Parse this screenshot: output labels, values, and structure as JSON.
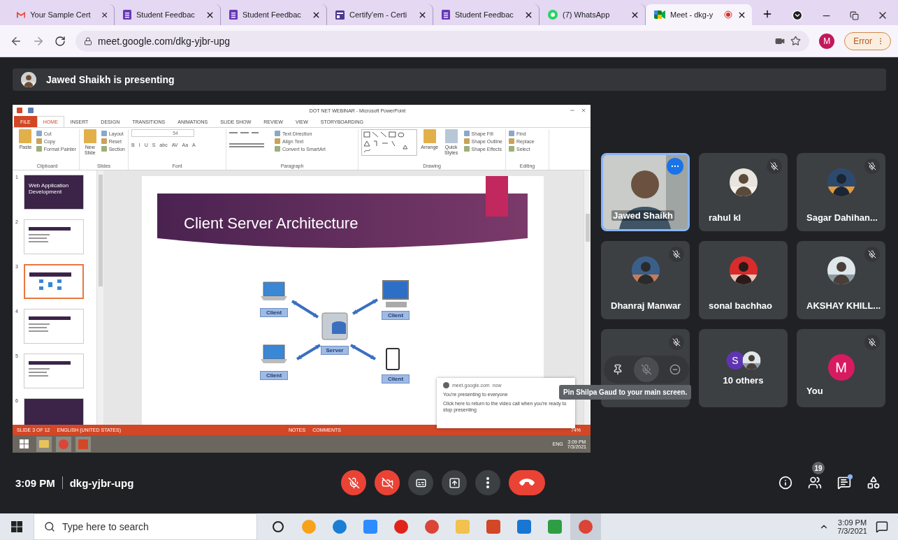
{
  "browser": {
    "tabs": [
      {
        "title": "Your Sample Cert",
        "kind": "mail",
        "selected": false
      },
      {
        "title": "Student Feedbac",
        "kind": "form",
        "selected": false
      },
      {
        "title": "Student Feedbac",
        "kind": "form",
        "selected": false
      },
      {
        "title": "Certify'em - Certi",
        "kind": "document",
        "selected": false
      },
      {
        "title": "Student Feedbac",
        "kind": "form",
        "selected": false
      },
      {
        "title": "(7) WhatsApp",
        "kind": "chat",
        "selected": false
      },
      {
        "title": "Meet - dkg-y",
        "kind": "video",
        "selected": true,
        "recording": true
      }
    ],
    "url": "meet.google.com/dkg-yjbr-upg",
    "profile_initial": "M",
    "error_label": "Error"
  },
  "presenter_bar": {
    "text": "Jawed Shaikh is presenting"
  },
  "powerpoint": {
    "title": "DOT NET WEBINAR - Microsoft PowerPoint",
    "ribbon_tabs": [
      {
        "label": "FILE",
        "kind": "file",
        "selected": false
      },
      {
        "label": "HOME",
        "kind": "tab",
        "selected": true
      },
      {
        "label": "INSERT",
        "kind": "tab",
        "selected": false
      },
      {
        "label": "DESIGN",
        "kind": "tab",
        "selected": false
      },
      {
        "label": "TRANSITIONS",
        "kind": "tab",
        "selected": false
      },
      {
        "label": "ANIMATIONS",
        "kind": "tab",
        "selected": false
      },
      {
        "label": "SLIDE SHOW",
        "kind": "tab",
        "selected": false
      },
      {
        "label": "REVIEW",
        "kind": "tab",
        "selected": false
      },
      {
        "label": "VIEW",
        "kind": "tab",
        "selected": false
      },
      {
        "label": "STORYBOARDING",
        "kind": "tab",
        "selected": false
      }
    ],
    "groups": [
      {
        "label": "Clipboard",
        "kind": "standard",
        "big": [
          "Paste"
        ],
        "small": [
          "Cut",
          "Copy",
          "Format Painter"
        ]
      },
      {
        "label": "Slides",
        "kind": "standard",
        "big": [
          "New Slide"
        ],
        "small": [
          "Layout",
          "Reset",
          "Section"
        ]
      },
      {
        "label": "Font",
        "kind": "font",
        "size": "54",
        "format_buttons": [
          "B",
          "I",
          "U",
          "S",
          "abc",
          "AV",
          "Aa",
          "A"
        ]
      },
      {
        "label": "Paragraph",
        "kind": "paragraph",
        "small": [
          "Text Direction",
          "Align Text",
          "Convert to SmartArt"
        ]
      },
      {
        "label": "Drawing",
        "kind": "drawing",
        "big": [
          "Arrange",
          "Quick Styles"
        ],
        "small": [
          "Shape Fill",
          "Shape Outline",
          "Shape Effects"
        ]
      },
      {
        "label": "Editing",
        "kind": "standard",
        "small": [
          "Find",
          "Replace",
          "Select"
        ]
      }
    ],
    "thumbnails": [
      {
        "number": "1",
        "kind": "title",
        "selected": false,
        "caption": "Web Application Development"
      },
      {
        "number": "2",
        "kind": "content",
        "selected": false
      },
      {
        "number": "3",
        "kind": "diagram",
        "selected": true
      },
      {
        "number": "4",
        "kind": "content",
        "selected": false
      },
      {
        "number": "5",
        "kind": "content",
        "selected": false
      },
      {
        "number": "6",
        "kind": "title",
        "selected": false
      }
    ],
    "slide": {
      "title": "Client Server Architecture",
      "server_label": "Server",
      "clients": [
        {
          "kind": "laptop",
          "label": "Client"
        },
        {
          "kind": "desktop",
          "label": "Client"
        },
        {
          "kind": "laptop",
          "label": "Client"
        },
        {
          "kind": "phone",
          "label": "Client"
        }
      ]
    },
    "status_bar": {
      "slide": "SLIDE 3 OF 12",
      "language": "ENGLISH (UNITED STATES)",
      "notes": "NOTES",
      "comments": "COMMENTS",
      "zoom": "74%"
    },
    "taskbar": {
      "language": "ENG",
      "time": "3:09 PM",
      "date": "7/3/2021"
    }
  },
  "notification": {
    "source": "meet.google.com",
    "time": "now",
    "title": "You're presenting to everyone",
    "body": "Click here to return to the video call when you're ready to stop presenting"
  },
  "participants": [
    {
      "kind": "video",
      "name": "Jawed Shaikh",
      "muted": false,
      "selected": true
    },
    {
      "name": "rahul kl",
      "muted": true,
      "selected": false
    },
    {
      "name": "Sagar Dahihan...",
      "muted": true,
      "selected": false
    },
    {
      "name": "Dhanraj Manwar",
      "muted": true,
      "selected": false
    },
    {
      "name": "sonal bachhao",
      "muted": false,
      "selected": false
    },
    {
      "name": "AKSHAY KHILL...",
      "muted": true,
      "selected": false
    },
    {
      "kind": "hover",
      "muted": true,
      "selected": false
    },
    {
      "kind": "others",
      "name": "10 others",
      "initial": "S",
      "muted": false,
      "selected": false
    },
    {
      "kind": "letter",
      "name": "You",
      "initial": "M",
      "muted": true,
      "selected": false
    }
  ],
  "tooltip": "Pin Shilpa Gaud to your main screen.",
  "meeting_bar": {
    "time": "3:09 PM",
    "code": "dkg-yjbr-upg",
    "controls": [
      {
        "kind": "mic",
        "off": true
      },
      {
        "kind": "camera",
        "off": true
      },
      {
        "kind": "captions",
        "off": false
      },
      {
        "kind": "present",
        "off": false
      },
      {
        "kind": "more",
        "off": false
      },
      {
        "kind": "leave"
      }
    ],
    "people_count": "19",
    "chat_unread": true
  },
  "taskbar": {
    "search_placeholder": "Type here to search",
    "time": "3:09 PM",
    "date": "7/3/2021"
  }
}
